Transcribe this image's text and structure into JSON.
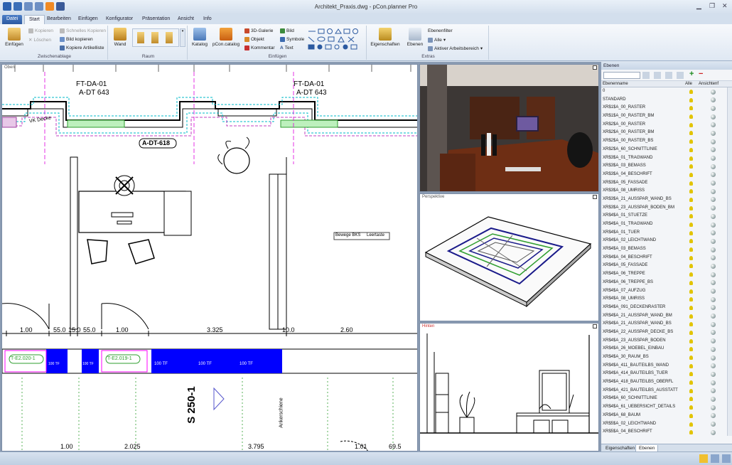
{
  "window": {
    "title": "Architekt_Praxis.dwg - pCon.planner Pro"
  },
  "tabs": [
    "Datei",
    "Start",
    "Bearbeiten",
    "Einfügen",
    "Konfigurator",
    "Präsentation",
    "Ansicht",
    "Info"
  ],
  "ribbon": {
    "einfuegen_label": "Einfügen",
    "kopieren": "Kopieren",
    "loeschen": "Löschen",
    "schnelles_kopieren": "Schnelles Kopieren",
    "bild_kopieren": "Bild kopieren",
    "kopiere_artikelliste": "Kopiere Artikelliste",
    "group_zwischenablage": "Zwischenablage",
    "wand": "Wand",
    "group_raum": "Raum",
    "katalog": "Katalog",
    "pcon_catalog": "pCon.catalog",
    "galerie3d": "3D-Galerie",
    "objekt": "Objekt",
    "kommentar": "Kommentar",
    "bild": "Bild",
    "symbole": "Symbole",
    "text": "Text",
    "group_einfuegen": "Einfügen",
    "eigenschaften": "Eigenschaften",
    "ebenen": "Ebenen",
    "ebenenfilter": "Ebenenfilter",
    "alle": "Alle",
    "aktiver_arbeitsbereich": "Aktiver Arbeitsbereich",
    "group_extras": "Extras"
  },
  "viewports": {
    "oben": "Oben",
    "perspektive": "Perspektive",
    "hinten": "Hinten"
  },
  "drawing": {
    "labels": [
      "FT-DA-01",
      "A-DT 643",
      "FT-DA-01",
      "A-DT 643"
    ],
    "room": "A-DT-618",
    "vkdecke": "VK Decke",
    "bewege": "Bewege BKS",
    "leertaste": "Leertaste",
    "dims_top": [
      "1.00",
      "55.0",
      "15.0",
      "55.0",
      "1.00",
      "3.325",
      "10.0",
      "2.60"
    ],
    "tags": [
      "T-E2.020-1",
      "T-E2.019-1"
    ],
    "tf": [
      "100 TF",
      "100 TF",
      "100 TF",
      "100 TF",
      "100 TF"
    ],
    "s250": "S 250-1",
    "ankerschiene": "Ankerschiene",
    "dims_bottom": [
      "1.00",
      "2.025",
      "3.795",
      "1.01",
      "69.5"
    ]
  },
  "panel": {
    "title": "Ebenen",
    "col_name": "Ebenenname",
    "col_alle": "Alle",
    "col_ansicht": "Ansichtenf",
    "layers": [
      "0",
      "STANDARD",
      "XR$1$A_00_RASTER",
      "XR$1$A_00_RASTER_BM",
      "XR$2$A_00_RASTER",
      "XR$2$A_00_RASTER_BM",
      "XR$2$A_00_RASTER_BS",
      "XR$2$A_60_SCHNITTLINIE",
      "XR$3$A_01_TRAGWAND",
      "XR$3$A_03_BEMASS",
      "XR$3$A_04_BESCHRIFT",
      "XR$3$A_05_FASSADE",
      "XR$3$A_08_UMRISS",
      "XR$3$A_21_AUSSPAR_WAND_BS",
      "XR$3$A_23_AUSSPAR_BODEN_BM",
      "XR$4$A_01_STUETZE",
      "XR$4$A_01_TRAGWAND",
      "XR$4$A_01_TUER",
      "XR$4$A_02_LEICHTWAND",
      "XR$4$A_03_BEMASS",
      "XR$4$A_04_BESCHRIFT",
      "XR$4$A_05_FASSADE",
      "XR$4$A_06_TREPPE",
      "XR$4$A_06_TREPPE_BS",
      "XR$4$A_07_AUFZUG",
      "XR$4$A_08_UMRISS",
      "XR$4$A_091_DECKENRASTER",
      "XR$4$A_21_AUSSPAR_WAND_BM",
      "XR$4$A_21_AUSSPAR_WAND_BS",
      "XR$4$A_22_AUSSPAR_DECKE_BS",
      "XR$4$A_23_AUSSPAR_BODEN",
      "XR$4$A_26_MOEBEL_EINBAU",
      "XR$4$A_30_RAUM_BS",
      "XR$4$A_411_BAUTEILBS_WAND",
      "XR$4$A_414_BAUTEILBS_TUER",
      "XR$4$A_418_BAUTEILBS_OBERFL",
      "XR$4$A_421_BAUTEILBS_AUSSTATT",
      "XR$4$A_60_SCHNITTLINIE",
      "XR$4$A_61_UEBERSICHT_DETAILS",
      "XR$4$A_68_BAUM",
      "XR$5$A_02_LEICHTWAND",
      "XR$5$A_04_BESCHRIFT"
    ],
    "tab_eigenschaften": "Eigenschaften",
    "tab_ebenen": "Ebenen"
  },
  "colors": {
    "accent": "#2c5aa0",
    "door_fill": "#0000ff",
    "tag_green": "#2e9e2e",
    "bulb": "#e2c400"
  }
}
